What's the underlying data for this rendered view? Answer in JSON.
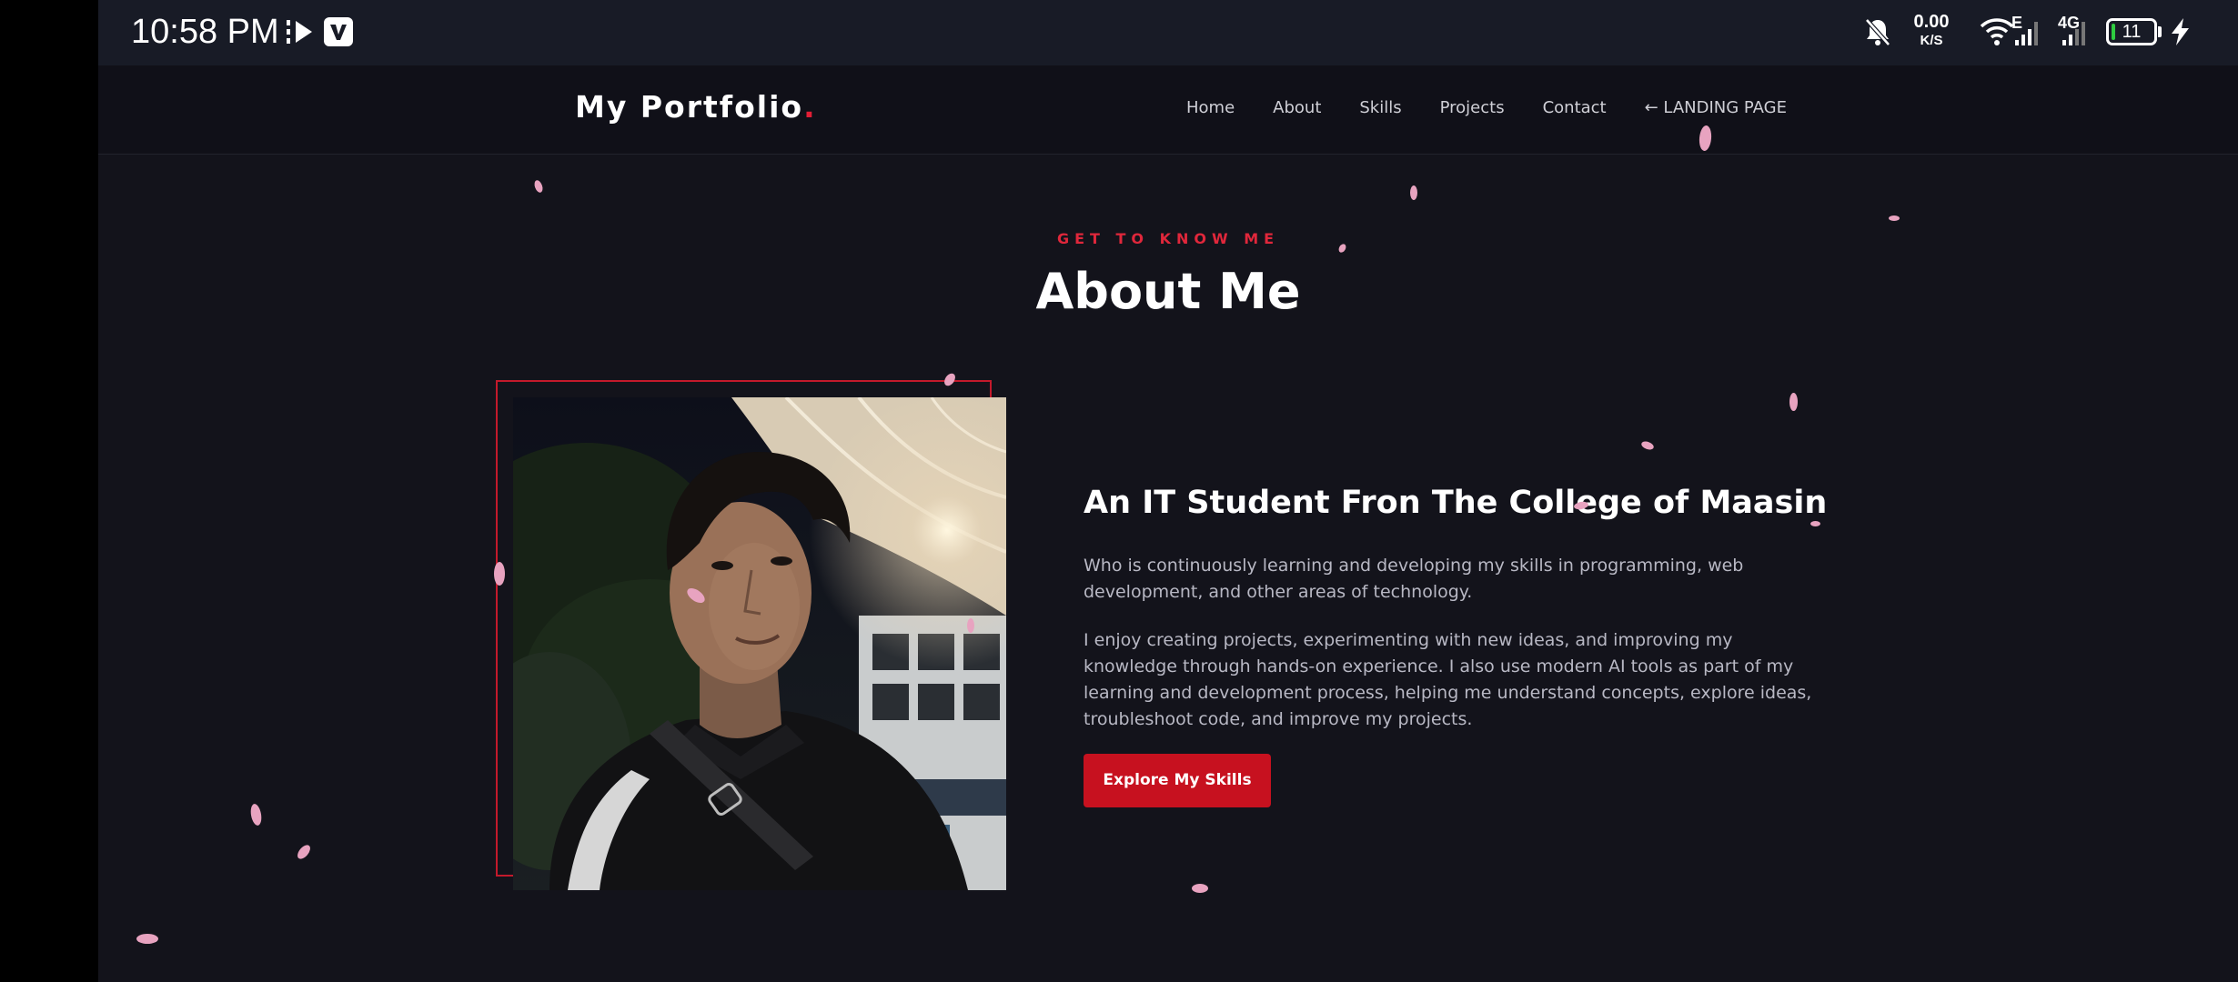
{
  "status_bar": {
    "time": "10:58 PM",
    "net_speed_value": "0.00",
    "net_speed_unit": "K/S",
    "network_e": "E",
    "network_4g": "4G",
    "battery_level": "11",
    "icons": [
      "youtube-music-icon",
      "v-app-icon",
      "bell-off-icon",
      "wifi-icon",
      "signal-icon",
      "signal-icon",
      "battery-icon",
      "charging-bolt-icon"
    ]
  },
  "nav": {
    "brand": "My Portfolio",
    "brand_dot": ".",
    "links": [
      "Home",
      "About",
      "Skills",
      "Projects",
      "Contact",
      "← LANDING PAGE"
    ]
  },
  "about": {
    "eyebrow": "GET TO KNOW ME",
    "title": "About Me",
    "heading": "An IT Student Fron The College of Maasin",
    "paragraph_1": "Who is continuously learning and developing my skills in programming, web development, and other areas of technology.",
    "paragraph_2": "I enjoy creating projects, experimenting with new ideas, and improving my knowledge through hands-on experience. I also use modern AI tools as part of my learning and development process, helping me understand concepts, explore ideas, troubleshoot code, and improve my projects.",
    "cta_label": "Explore My Skills"
  },
  "colors": {
    "accent": "#e31e35",
    "background": "#13131b",
    "button": "#c7111f",
    "petal": "#e8a3c0"
  }
}
